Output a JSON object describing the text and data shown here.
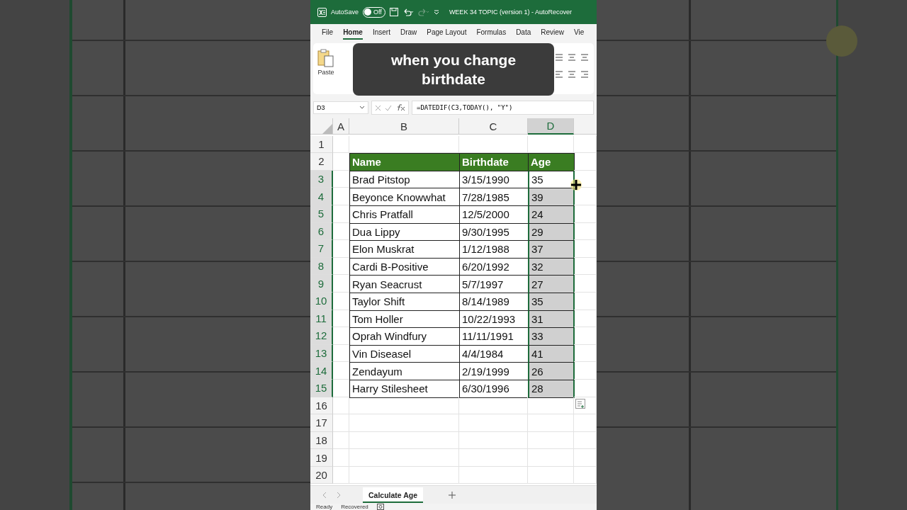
{
  "title_bar": {
    "autosave_label": "AutoSave",
    "autosave_on": false,
    "toggle_text": "Off",
    "title": "WEEK 34 TOPIC (version 1)  -  AutoRecover"
  },
  "menu_tabs": [
    {
      "label": "File",
      "selected": false
    },
    {
      "label": "Home",
      "selected": true
    },
    {
      "label": "Insert",
      "selected": false
    },
    {
      "label": "Draw",
      "selected": false
    },
    {
      "label": "Page Layout",
      "selected": false
    },
    {
      "label": "Formulas",
      "selected": false
    },
    {
      "label": "Data",
      "selected": false
    },
    {
      "label": "Review",
      "selected": false
    },
    {
      "label": "Vie",
      "selected": false
    }
  ],
  "ribbon": {
    "paste": "Paste"
  },
  "caption": "when you change birthdate",
  "formula_bar": {
    "name_box": "D3",
    "formula": "=DATEDIF(C3,TODAY(), \"Y\")"
  },
  "columns": [
    {
      "label": "A",
      "selected": false
    },
    {
      "label": "B",
      "selected": false
    },
    {
      "label": "C",
      "selected": false
    },
    {
      "label": "D",
      "selected": true
    }
  ],
  "rows": [
    {
      "number": "1",
      "kind": "blank"
    },
    {
      "number": "2",
      "kind": "header",
      "cells": [
        "Name",
        "Birthdate",
        "Age"
      ]
    },
    {
      "number": "3",
      "kind": "data",
      "cells": [
        "Brad Pitstop",
        "3/15/1990",
        "35"
      ],
      "selected": true,
      "active": true
    },
    {
      "number": "4",
      "kind": "data",
      "cells": [
        "Beyonce Knowwhat",
        "7/28/1985",
        "39"
      ],
      "selected": true,
      "active": false
    },
    {
      "number": "5",
      "kind": "data",
      "cells": [
        "Chris Pratfall",
        "12/5/2000",
        "24"
      ],
      "selected": true,
      "active": false
    },
    {
      "number": "6",
      "kind": "data",
      "cells": [
        "Dua Lippy",
        "9/30/1995",
        "29"
      ],
      "selected": true,
      "active": false
    },
    {
      "number": "7",
      "kind": "data",
      "cells": [
        "Elon Muskrat",
        "1/12/1988",
        "37"
      ],
      "selected": true,
      "active": false
    },
    {
      "number": "8",
      "kind": "data",
      "cells": [
        "Cardi B-Positive",
        "6/20/1992",
        "32"
      ],
      "selected": true,
      "active": false
    },
    {
      "number": "9",
      "kind": "data",
      "cells": [
        "Ryan Seacrust",
        "5/7/1997",
        "27"
      ],
      "selected": true,
      "active": false
    },
    {
      "number": "10",
      "kind": "data",
      "cells": [
        "Taylor Shift",
        "8/14/1989",
        "35"
      ],
      "selected": true,
      "active": false
    },
    {
      "number": "11",
      "kind": "data",
      "cells": [
        "Tom Holler",
        "10/22/1993",
        "31"
      ],
      "selected": true,
      "active": false
    },
    {
      "number": "12",
      "kind": "data",
      "cells": [
        "Oprah Windfury",
        "11/11/1991",
        "33"
      ],
      "selected": true,
      "active": false
    },
    {
      "number": "13",
      "kind": "data",
      "cells": [
        "Vin Diseasel",
        "4/4/1984",
        "41"
      ],
      "selected": true,
      "active": false
    },
    {
      "number": "14",
      "kind": "data",
      "cells": [
        "Zendayum",
        "2/19/1999",
        "26"
      ],
      "selected": true,
      "active": false
    },
    {
      "number": "15",
      "kind": "data",
      "cells": [
        "Harry Stilesheet",
        "6/30/1996",
        "28"
      ],
      "selected": true,
      "active": false
    },
    {
      "number": "16",
      "kind": "blank"
    },
    {
      "number": "17",
      "kind": "blank"
    },
    {
      "number": "18",
      "kind": "blank"
    },
    {
      "number": "19",
      "kind": "blank"
    },
    {
      "number": "20",
      "kind": "blank"
    }
  ],
  "sheet_tabs": [
    {
      "label": "Calculate Age",
      "selected": true
    }
  ],
  "status_bar": {
    "ready": "Ready",
    "recovered": "Recovered"
  }
}
